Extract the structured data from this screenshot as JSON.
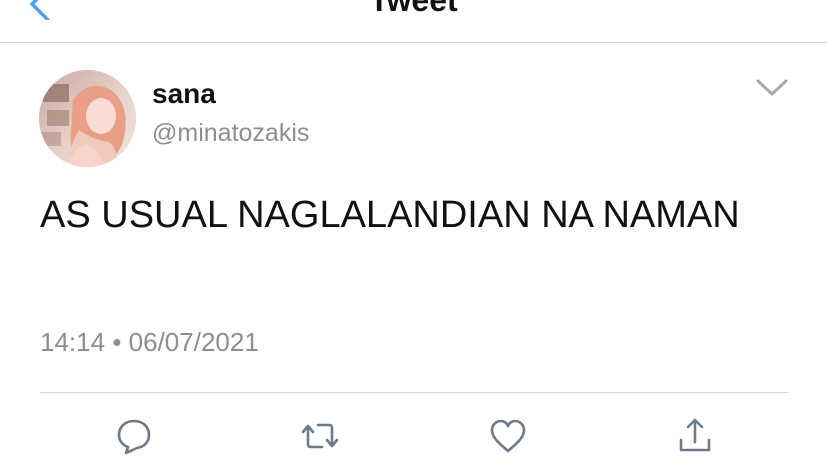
{
  "header": {
    "title": "Tweet",
    "back_icon": "back-chevron-icon",
    "accent_color": "#4a9ff0"
  },
  "author": {
    "display_name": "sana",
    "handle": "@minatozakis",
    "avatar_icon": "profile-avatar"
  },
  "tweet": {
    "text": "AS USUAL NAGLALANDIAN NA NAMAN",
    "time": "14:14",
    "separator": "•",
    "date": "06/07/2021"
  },
  "actions": [
    {
      "name": "reply",
      "icon": "reply-icon"
    },
    {
      "name": "retweet",
      "icon": "retweet-icon"
    },
    {
      "name": "like",
      "icon": "heart-icon"
    },
    {
      "name": "share",
      "icon": "share-icon"
    }
  ],
  "colors": {
    "text": "#111111",
    "muted": "#8a8f94",
    "icon": "#6b7b8a",
    "divider": "#d6d6d6"
  }
}
